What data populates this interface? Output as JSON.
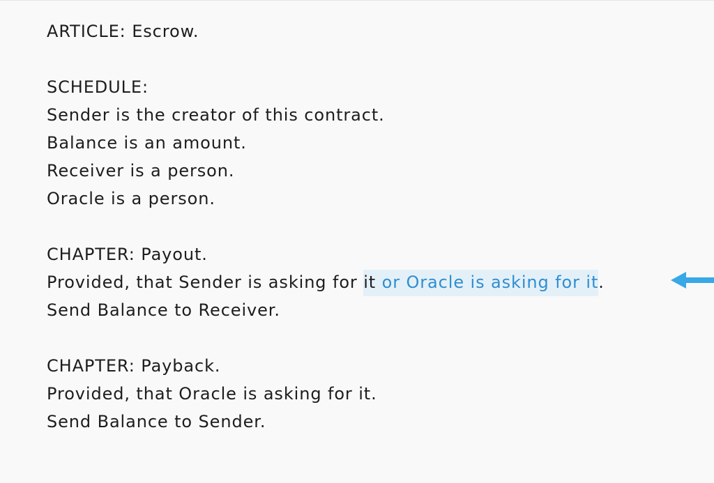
{
  "document": {
    "article": "ARTICLE: Escrow.",
    "schedule_heading": "SCHEDULE:",
    "schedule_lines": [
      "Sender is the creator of this contract.",
      "Balance is an amount.",
      "Receiver is a person.",
      "Oracle is a person."
    ],
    "chapter_payout": {
      "heading": "CHAPTER: Payout.",
      "condition_prefix": "Provided, that Sender is asking for ",
      "highlight_existing": "it",
      "highlight_added": " or Oracle is asking for it",
      "condition_suffix": ".",
      "action": "Send Balance to Receiver."
    },
    "chapter_payback": {
      "heading": "CHAPTER: Payback.",
      "condition": "Provided, that Oracle is asking for it.",
      "action": "Send Balance to Sender."
    }
  },
  "colors": {
    "background": "#f9f9f9",
    "text": "#1d1d1d",
    "highlight_bg": "#e4f0f8",
    "highlight_text": "#2f8ed0",
    "arrow": "#38a8e6"
  },
  "icons": {
    "arrow": "arrow-left-icon"
  }
}
